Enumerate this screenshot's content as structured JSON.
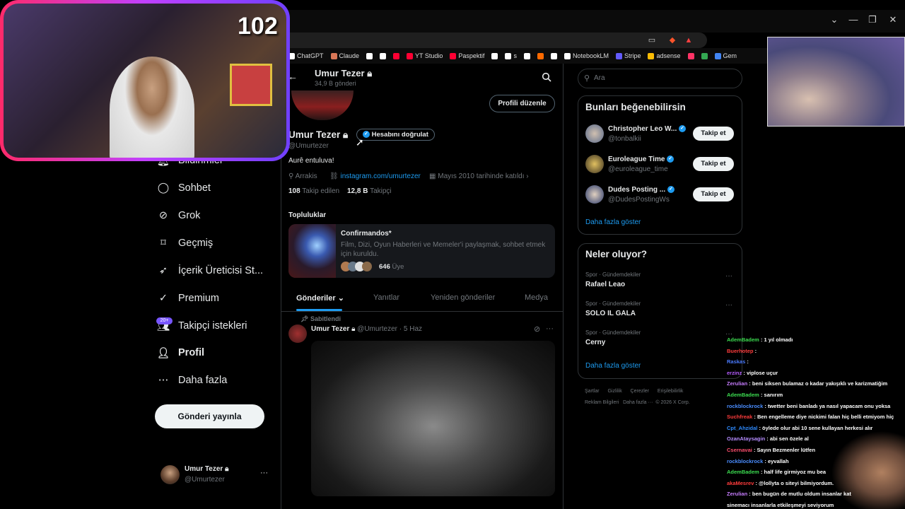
{
  "overlay": {
    "counter": "102"
  },
  "browser": {
    "window_controls": [
      "⌄",
      "—",
      "❐",
      "✕"
    ],
    "bookmarks": [
      {
        "label": "ChatGPT",
        "color": "#ffffff"
      },
      {
        "label": "Claude",
        "color": "#d97757"
      },
      {
        "label": "",
        "color": "#ffffff"
      },
      {
        "label": "",
        "color": "#ffffff"
      },
      {
        "label": "",
        "color": "#ff0033"
      },
      {
        "label": "YT Studio",
        "color": "#ff0033"
      },
      {
        "label": "Paspektif",
        "color": "#ff0033"
      },
      {
        "label": "",
        "color": "#ffffff"
      },
      {
        "label": "s",
        "color": "#ffffff"
      },
      {
        "label": "",
        "color": "#ffffff"
      },
      {
        "label": "",
        "color": "#ff6a00"
      },
      {
        "label": "",
        "color": "#ffffff"
      },
      {
        "label": "NotebookLM",
        "color": "#ffffff"
      },
      {
        "label": "Stripe",
        "color": "#635bff"
      },
      {
        "label": "adsense",
        "color": "#fbbc04"
      },
      {
        "label": "",
        "color": "#ff3366"
      },
      {
        "label": "",
        "color": "#34a853"
      },
      {
        "label": "Gem",
        "color": "#4285f4"
      }
    ]
  },
  "nav": {
    "items": [
      {
        "label": "Bildirimler",
        "icon": "bell-icon"
      },
      {
        "label": "Sohbet",
        "icon": "chat-icon"
      },
      {
        "label": "Grok",
        "icon": "grok-icon"
      },
      {
        "label": "Geçmiş",
        "icon": "bookmark-icon"
      },
      {
        "label": "İçerik Üreticisi St...",
        "icon": "rocket-icon"
      },
      {
        "label": "Premium",
        "icon": "premium-icon"
      },
      {
        "label": "Takipçi istekleri",
        "icon": "follow-requests-icon"
      },
      {
        "label": "Profil",
        "icon": "profile-icon"
      },
      {
        "label": "Daha fazla",
        "icon": "more-circle-icon"
      }
    ],
    "follow_badge": "20+",
    "post_button": "Gönderi yayınla",
    "account": {
      "name": "Umur Tezer",
      "handle": "@Umurtezer",
      "more": "···"
    }
  },
  "profile": {
    "header_name": "Umur Tezer",
    "header_posts": "34,9 B gönderi",
    "edit_button": "Profili düzenle",
    "name": "Umur Tezer",
    "verify_button": "Hesabını doğrulat",
    "handle": "@Umurtezer",
    "bio": "Aurê entuluva!",
    "location": "Arrakis",
    "link": "instagram.com/umurtezer",
    "joined": "Mayıs 2010 tarihinde katıldı",
    "following_count": "108",
    "following_label": "Takip edilen",
    "followers_count": "12,8 B",
    "followers_label": "Takipçi",
    "communities_title": "Topluluklar",
    "community": {
      "name": "Confirmandos*",
      "desc": "Film, Dizi, Oyun Haberleri ve Memeler'i paylaşmak, sohbet etmek için kuruldu.",
      "members_count": "646",
      "members_label": "Üye"
    },
    "tabs": [
      "Gönderiler",
      "Yanıtlar",
      "Yeniden gönderiler",
      "Medya"
    ],
    "pinned_label": "Sabitlendi",
    "post": {
      "name": "Umur Tezer",
      "handle": "@Umurtezer",
      "sep": "·",
      "date": "5 Haz",
      "more": "···"
    }
  },
  "search": {
    "placeholder": "Ara"
  },
  "suggestions": {
    "title": "Bunları beğenebilirsin",
    "users": [
      {
        "name": "Christopher Leo W...",
        "handle": "@tonbalkii",
        "button": "Takip et"
      },
      {
        "name": "Euroleague Time",
        "handle": "@euroleague_time",
        "button": "Takip et"
      },
      {
        "name": "Dudes Posting ...",
        "handle": "@DudesPostingWs",
        "button": "Takip et"
      }
    ],
    "more": "Daha fazla göster"
  },
  "trends": {
    "title": "Neler oluyor?",
    "items": [
      {
        "category": "Spor · Gündemdekiler",
        "name": "Rafael Leao"
      },
      {
        "category": "Spor · Gündemdekiler",
        "name": "SOLO IL GALA"
      },
      {
        "category": "Spor · Gündemdekiler",
        "name": "Cerny"
      }
    ],
    "more": "Daha fazla göster"
  },
  "footer": {
    "row1": [
      "Şartlar",
      "Gizlilik",
      "Çerezler",
      "Erişilebilirlik"
    ],
    "row2": [
      "Reklam Bilgileri",
      "Daha fazla ···",
      "© 2026 X Corp."
    ]
  },
  "chat": [
    {
      "user": "AdemBadem",
      "color": "#3cdc50",
      "msg": ": 1 yıl olmadı"
    },
    {
      "user": "Buerhotep",
      "color": "#ff3c3c",
      "msg": ":"
    },
    {
      "user": "Raskas",
      "color": "#4a7bff",
      "msg": ":"
    },
    {
      "user": "erzinz",
      "color": "#b55cff",
      "msg": ": viplose uçur"
    },
    {
      "user": "Zerulian",
      "color": "#c77dff",
      "msg": ": beni siksen bulamaz o kadar yakışıklı ve karizmatiğim"
    },
    {
      "user": "AdemBadem",
      "color": "#3cdc50",
      "msg": ": sanırım"
    },
    {
      "user": "rockblockrock",
      "color": "#4a8dff",
      "msg": ": twetter beni banladı ya nasıl yapacam onu yoksa"
    },
    {
      "user": "Suchfreak",
      "color": "#ff3c3c",
      "msg": ": Ben engelleme diye nickimi falan hiç belli etmiyom hiç"
    },
    {
      "user": "Cpt_Ahzidal",
      "color": "#2e8bff",
      "msg": ": öylede olur abi 10 sene kullayan herkesi alır"
    },
    {
      "user": "OzanAtaysagin",
      "color": "#b58cff",
      "msg": ": abi sen özele al"
    },
    {
      "user": "Csernavai",
      "color": "#ff4f6f",
      "msg": ": Sayın Bezmenler lütfen"
    },
    {
      "user": "rockblockrock",
      "color": "#4a8dff",
      "msg": ": eyvallah"
    },
    {
      "user": "AdemBadem",
      "color": "#3cdc50",
      "msg": ": half life girmiyoz mu bea"
    },
    {
      "user": "akaMesrev",
      "color": "#ff3c3c",
      "msg": ": @lollyta o siteyi bilmiyordum."
    },
    {
      "user": "Zerulian",
      "color": "#c77dff",
      "msg": ": ben bugün de mutlu oldum insanlar kat"
    },
    {
      "user": "",
      "color": "#ffffff",
      "msg": "sinemacı insanlarla etkileşmeyi seviyorum"
    }
  ]
}
